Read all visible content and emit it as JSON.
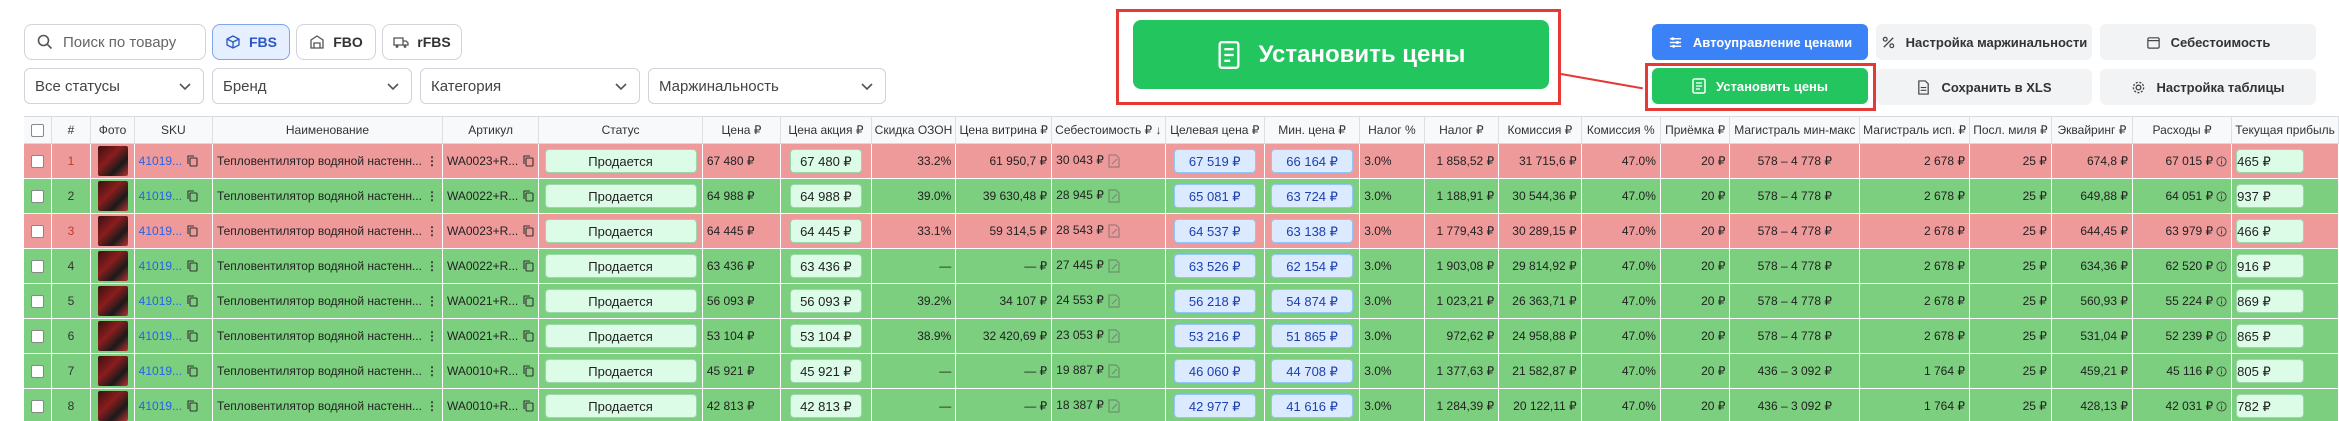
{
  "search": {
    "placeholder": "Поиск по товару"
  },
  "modes": [
    {
      "label": "FBS",
      "icon": "box-icon"
    },
    {
      "label": "FBO",
      "icon": "warehouse-icon"
    },
    {
      "label": "rFBS",
      "icon": "truck-icon"
    }
  ],
  "filters": {
    "status": "Все статусы",
    "brand": "Бренд",
    "category": "Категория",
    "margin": "Маржинальность"
  },
  "actions": {
    "set_prices_big": "Установить цены",
    "set_prices_small": "Установить цены",
    "auto_prices": "Автоуправление ценами",
    "margin_settings": "Настройка маржинальности",
    "cost": "Себестоимость",
    "save_xls": "Сохранить в XLS",
    "table_settings": "Настройка таблицы"
  },
  "colors": {
    "green": "#22c55e",
    "blue": "#3b82f6",
    "red_outline": "#e53935",
    "row_red": "#ef9a9a",
    "row_green": "#7ccf7e"
  },
  "table": {
    "headers": [
      "#",
      "Фото",
      "SKU",
      "Наименование",
      "Артикул",
      "Статус",
      "Цена ₽",
      "Цена акция ₽",
      "Скидка ОЗОН",
      "Цена витрина ₽",
      "Себестоимость ₽ ↓",
      "Целевая цена ₽",
      "Мин. цена ₽",
      "Налог %",
      "Налог ₽",
      "Комиссия ₽",
      "Комиссия %",
      "Приёмка ₽",
      "Магистраль мин-макс",
      "Магистраль исп. ₽",
      "Посл. миля ₽",
      "Эквайринг ₽",
      "Расходы ₽",
      "Текущая прибыль"
    ],
    "rows": [
      {
        "n": "1",
        "sku": "41019...",
        "name": "Тепловентилятор водяной настенн...",
        "art": "WA0023+R...",
        "status": "Продается",
        "price": "67 480 ₽",
        "promo": "67 480 ₽",
        "disc": "33.2%",
        "shelf": "61 950,7 ₽",
        "cost": "30 043 ₽",
        "target": "67 519 ₽",
        "min": "66 164 ₽",
        "taxp": "3.0%",
        "tax": "1 858,52 ₽",
        "comm": "31 715,6 ₽",
        "commp": "47.0%",
        "accept": "20 ₽",
        "mag": "578 – 4 778 ₽",
        "magu": "2 678 ₽",
        "last": "25 ₽",
        "acq": "674,8 ₽",
        "exp": "67 015 ₽",
        "profit": "465 ₽",
        "color": "red"
      },
      {
        "n": "2",
        "sku": "41019...",
        "name": "Тепловентилятор водяной настенн...",
        "art": "WA0022+R...",
        "status": "Продается",
        "price": "64 988 ₽",
        "promo": "64 988 ₽",
        "disc": "39.0%",
        "shelf": "39 630,48 ₽",
        "cost": "28 945 ₽",
        "target": "65 081 ₽",
        "min": "63 724 ₽",
        "taxp": "3.0%",
        "tax": "1 188,91 ₽",
        "comm": "30 544,36 ₽",
        "commp": "47.0%",
        "accept": "20 ₽",
        "mag": "578 – 4 778 ₽",
        "magu": "2 678 ₽",
        "last": "25 ₽",
        "acq": "649,88 ₽",
        "exp": "64 051 ₽",
        "profit": "937 ₽",
        "color": "green"
      },
      {
        "n": "3",
        "sku": "41019...",
        "name": "Тепловентилятор водяной настенн...",
        "art": "WA0023+R...",
        "status": "Продается",
        "price": "64 445 ₽",
        "promo": "64 445 ₽",
        "disc": "33.1%",
        "shelf": "59 314,5 ₽",
        "cost": "28 543 ₽",
        "target": "64 537 ₽",
        "min": "63 138 ₽",
        "taxp": "3.0%",
        "tax": "1 779,43 ₽",
        "comm": "30 289,15 ₽",
        "commp": "47.0%",
        "accept": "20 ₽",
        "mag": "578 – 4 778 ₽",
        "magu": "2 678 ₽",
        "last": "25 ₽",
        "acq": "644,45 ₽",
        "exp": "63 979 ₽",
        "profit": "466 ₽",
        "color": "red"
      },
      {
        "n": "4",
        "sku": "41019...",
        "name": "Тепловентилятор водяной настенн...",
        "art": "WA0022+R...",
        "status": "Продается",
        "price": "63 436 ₽",
        "promo": "63 436 ₽",
        "disc": "—",
        "shelf": "— ₽",
        "cost": "27 445 ₽",
        "target": "63 526 ₽",
        "min": "62 154 ₽",
        "taxp": "3.0%",
        "tax": "1 903,08 ₽",
        "comm": "29 814,92 ₽",
        "commp": "47.0%",
        "accept": "20 ₽",
        "mag": "578 – 4 778 ₽",
        "magu": "2 678 ₽",
        "last": "25 ₽",
        "acq": "634,36 ₽",
        "exp": "62 520 ₽",
        "profit": "916 ₽",
        "color": "green"
      },
      {
        "n": "5",
        "sku": "41019...",
        "name": "Тепловентилятор водяной настенн...",
        "art": "WA0021+R...",
        "status": "Продается",
        "price": "56 093 ₽",
        "promo": "56 093 ₽",
        "disc": "39.2%",
        "shelf": "34 107 ₽",
        "cost": "24 553 ₽",
        "target": "56 218 ₽",
        "min": "54 874 ₽",
        "taxp": "3.0%",
        "tax": "1 023,21 ₽",
        "comm": "26 363,71 ₽",
        "commp": "47.0%",
        "accept": "20 ₽",
        "mag": "578 – 4 778 ₽",
        "magu": "2 678 ₽",
        "last": "25 ₽",
        "acq": "560,93 ₽",
        "exp": "55 224 ₽",
        "profit": "869 ₽",
        "color": "green"
      },
      {
        "n": "6",
        "sku": "41019...",
        "name": "Тепловентилятор водяной настенн...",
        "art": "WA0021+R...",
        "status": "Продается",
        "price": "53 104 ₽",
        "promo": "53 104 ₽",
        "disc": "38.9%",
        "shelf": "32 420,69 ₽",
        "cost": "23 053 ₽",
        "target": "53 216 ₽",
        "min": "51 865 ₽",
        "taxp": "3.0%",
        "tax": "972,62 ₽",
        "comm": "24 958,88 ₽",
        "commp": "47.0%",
        "accept": "20 ₽",
        "mag": "578 – 4 778 ₽",
        "magu": "2 678 ₽",
        "last": "25 ₽",
        "acq": "531,04 ₽",
        "exp": "52 239 ₽",
        "profit": "865 ₽",
        "color": "green"
      },
      {
        "n": "7",
        "sku": "41019...",
        "name": "Тепловентилятор водяной настенн...",
        "art": "WA0010+R...",
        "status": "Продается",
        "price": "45 921 ₽",
        "promo": "45 921 ₽",
        "disc": "—",
        "shelf": "— ₽",
        "cost": "19 887 ₽",
        "target": "46 060 ₽",
        "min": "44 708 ₽",
        "taxp": "3.0%",
        "tax": "1 377,63 ₽",
        "comm": "21 582,87 ₽",
        "commp": "47.0%",
        "accept": "20 ₽",
        "mag": "436 – 3 092 ₽",
        "magu": "1 764 ₽",
        "last": "25 ₽",
        "acq": "459,21 ₽",
        "exp": "45 116 ₽",
        "profit": "805 ₽",
        "color": "green"
      },
      {
        "n": "8",
        "sku": "41019...",
        "name": "Тепловентилятор водяной настенн...",
        "art": "WA0010+R...",
        "status": "Продается",
        "price": "42 813 ₽",
        "promo": "42 813 ₽",
        "disc": "—",
        "shelf": "— ₽",
        "cost": "18 387 ₽",
        "target": "42 977 ₽",
        "min": "41 616 ₽",
        "taxp": "3.0%",
        "tax": "1 284,39 ₽",
        "comm": "20 122,11 ₽",
        "commp": "47.0%",
        "accept": "20 ₽",
        "mag": "436 – 3 092 ₽",
        "magu": "1 764 ₽",
        "last": "25 ₽",
        "acq": "428,13 ₽",
        "exp": "42 031 ₽",
        "profit": "782 ₽",
        "color": "green"
      }
    ]
  }
}
